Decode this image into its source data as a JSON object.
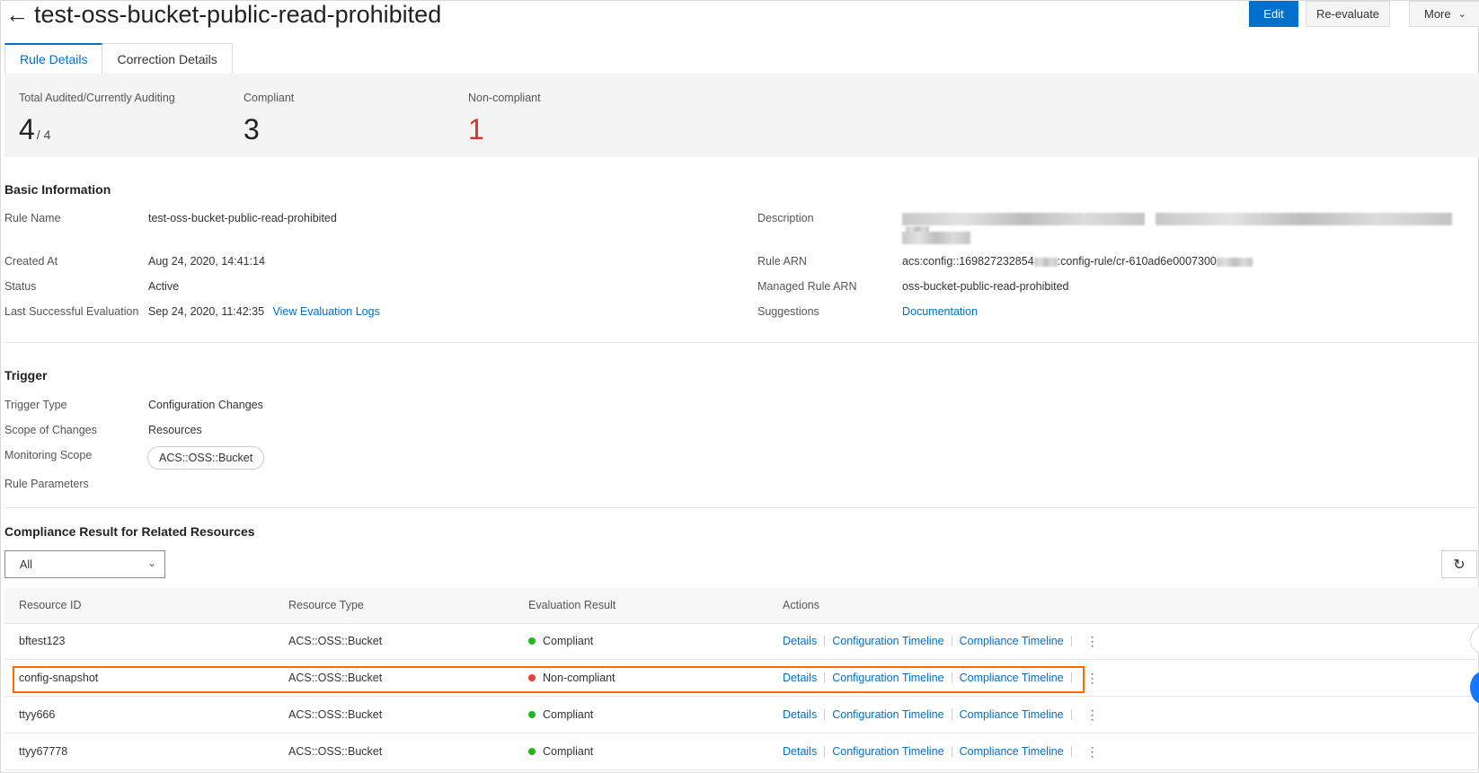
{
  "header": {
    "title": "test-oss-bucket-public-read-prohibited",
    "edit": "Edit",
    "reevaluate": "Re-evaluate",
    "more": "More"
  },
  "tabs": [
    {
      "label": "Rule Details"
    },
    {
      "label": "Correction Details"
    }
  ],
  "stats": {
    "total_label": "Total Audited/Currently Auditing",
    "total_value": "4",
    "total_sub": "/ 4",
    "compliant_label": "Compliant",
    "compliant_value": "3",
    "noncompliant_label": "Non-compliant",
    "noncompliant_value": "1"
  },
  "basic": {
    "title": "Basic Information",
    "rule_name_label": "Rule Name",
    "rule_name": "test-oss-bucket-public-read-prohibited",
    "created_label": "Created At",
    "created": "Aug 24, 2020, 14:41:14",
    "status_label": "Status",
    "status": "Active",
    "last_eval_label": "Last Successful Evaluation",
    "last_eval": "Sep 24, 2020, 11:42:35",
    "view_logs": "View Evaluation Logs",
    "description_label": "Description",
    "rule_arn_label": "Rule ARN",
    "rule_arn_prefix": "acs:config::169827232854",
    "rule_arn_mid": ":config-rule/cr-610ad6e0007300",
    "managed_arn_label": "Managed Rule ARN",
    "managed_arn": "oss-bucket-public-read-prohibited",
    "suggestions_label": "Suggestions",
    "documentation": "Documentation"
  },
  "trigger": {
    "title": "Trigger",
    "type_label": "Trigger Type",
    "type": "Configuration Changes",
    "scope_label": "Scope of Changes",
    "scope": "Resources",
    "monitoring_label": "Monitoring Scope",
    "monitoring_tag": "ACS::OSS::Bucket",
    "params_label": "Rule Parameters"
  },
  "compliance": {
    "title": "Compliance Result for Related Resources",
    "filter": "All",
    "columns": {
      "resource_id": "Resource ID",
      "resource_type": "Resource Type",
      "evaluation": "Evaluation Result",
      "actions": "Actions"
    },
    "action_labels": {
      "details": "Details",
      "config_timeline": "Configuration Timeline",
      "compliance_timeline": "Compliance Timeline"
    },
    "rows": [
      {
        "id": "bftest123",
        "type": "ACS::OSS::Bucket",
        "result": "Compliant",
        "color": "#1fb81f"
      },
      {
        "id": "config-snapshot",
        "type": "ACS::OSS::Bucket",
        "result": "Non-compliant",
        "color": "#e8423a"
      },
      {
        "id": "ttyy666",
        "type": "ACS::OSS::Bucket",
        "result": "Compliant",
        "color": "#1fb81f"
      },
      {
        "id": "ttyy67778",
        "type": "ACS::OSS::Bucket",
        "result": "Compliant",
        "color": "#1fb81f"
      }
    ]
  },
  "colors": {
    "primary": "#0070cc",
    "danger": "#d93026",
    "highlight": "#ff6a00"
  }
}
